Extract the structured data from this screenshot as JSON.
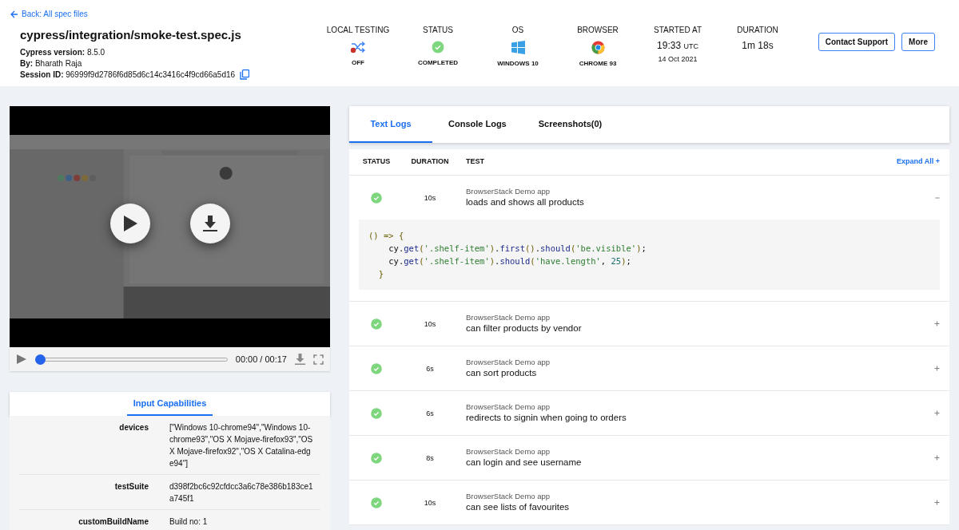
{
  "header": {
    "back_link": "Back: All spec files",
    "title": "cypress/integration/smoke-test.spec.js",
    "details": [
      {
        "label": "Cypress version:",
        "value": "8.5.0"
      },
      {
        "label": "By:",
        "value": "Bharath Raja"
      },
      {
        "label": "Session ID:",
        "value": "96999f9d2786f6d85d6c14c3416c4f9cd66a5d16"
      }
    ],
    "meta": [
      {
        "kind": "icon",
        "label": "LOCAL TESTING",
        "value": "OFF",
        "on": false
      },
      {
        "kind": "icon",
        "label": "STATUS",
        "value": "COMPLETED"
      },
      {
        "kind": "icon",
        "label": "OS",
        "value": "WINDOWS 10"
      },
      {
        "kind": "icon",
        "label": "BROWSER",
        "value": "CHROME 93"
      },
      {
        "kind": "time",
        "label": "STARTED AT",
        "value": "19:33",
        "unit": "UTC",
        "date": "14 Oct 2021"
      },
      {
        "kind": "text",
        "label": "DURATION",
        "value": "1m 18s"
      }
    ],
    "buttons": [
      "Contact Support",
      "More"
    ]
  },
  "video": {
    "time": "00:00 / 00:17",
    "progress": {
      "level": 0
    }
  },
  "capabilities": {
    "tab": "Input Capabilities",
    "rows": [
      {
        "key": "devices",
        "value": "[\"Windows 10-chrome94\",\"Windows 10-chrome93\",\"OS X Mojave-firefox93\",\"OS X Mojave-firefox92\",\"OS X Catalina-edge94\"]"
      },
      {
        "key": "testSuite",
        "value": "d398f2bc6c92cfdcc3a6c78e386b183ce1a745f1"
      },
      {
        "key": "customBuildName",
        "value": "Build no: 1"
      }
    ]
  },
  "log_tabs": [
    {
      "label": "Text Logs",
      "selected": true
    },
    {
      "label": "Console Logs",
      "selected": false
    },
    {
      "label": "Screenshots(0)",
      "selected": false
    }
  ],
  "tests": {
    "columns": [
      "STATUS",
      "DURATION",
      "TEST"
    ],
    "expand_all": "Expand All +",
    "rows": [
      {
        "passed": true,
        "duration": "10s",
        "suite": "BrowserStack Demo app",
        "name": "loads and shows all products",
        "expanded": true,
        "code": [
          "() => {",
          "    cy.get('.shelf-item').first().should('be.visible');",
          "    cy.get('.shelf-item').should('have.length', 25);",
          "  }"
        ]
      },
      {
        "passed": true,
        "duration": "10s",
        "suite": "BrowserStack Demo app",
        "name": "can filter products by vendor",
        "expanded": false
      },
      {
        "passed": true,
        "duration": "6s",
        "suite": "BrowserStack Demo app",
        "name": "can sort products",
        "expanded": false
      },
      {
        "passed": true,
        "duration": "6s",
        "suite": "BrowserStack Demo app",
        "name": "redirects to signin when going to orders",
        "expanded": false
      },
      {
        "passed": true,
        "duration": "8s",
        "suite": "BrowserStack Demo app",
        "name": "can login and see username",
        "expanded": false
      },
      {
        "passed": true,
        "duration": "10s",
        "suite": "BrowserStack Demo app",
        "name": "can see lists of favourites",
        "expanded": false
      }
    ]
  }
}
